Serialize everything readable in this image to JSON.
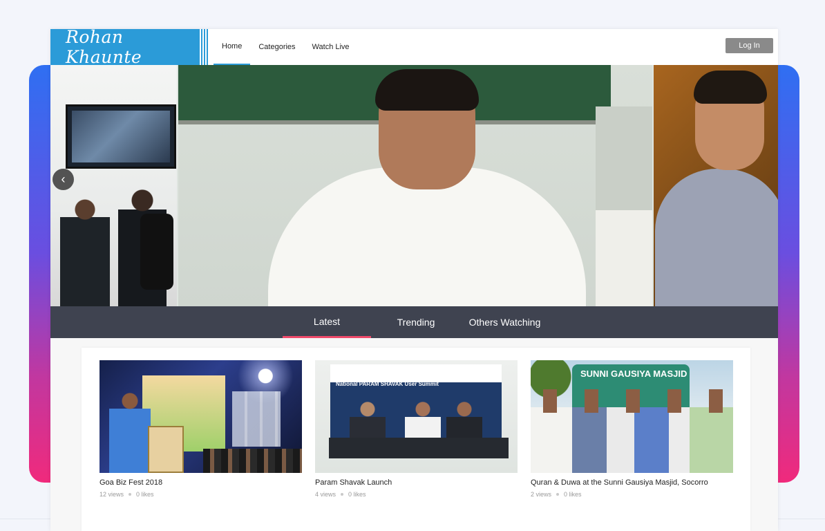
{
  "brand": {
    "name": "Rohan Khaunte"
  },
  "nav": {
    "links": [
      {
        "label": "Home",
        "active": true
      },
      {
        "label": "Categories",
        "active": false
      },
      {
        "label": "Watch Live",
        "active": false
      }
    ],
    "login_label": "Log In"
  },
  "hero": {
    "prev_icon": "‹",
    "slides": 3
  },
  "tabs": [
    {
      "label": "Latest",
      "active": true
    },
    {
      "label": "Trending",
      "active": false
    },
    {
      "label": "Others Watching",
      "active": false
    }
  ],
  "videos": [
    {
      "title": "Goa Biz Fest 2018",
      "views": "12 views",
      "likes": "0 likes"
    },
    {
      "title": "Param Shavak Launch",
      "views": "4 views",
      "likes": "0 likes"
    },
    {
      "title": "Quran & Duwa at the Sunni Gausiya Masjid, Socorro",
      "views": "2 views",
      "likes": "0 likes"
    }
  ],
  "thumb_text": {
    "param": "National PARAM SHAVAK User Summit",
    "masjid": "SUNNI GAUSIYA MASJID"
  },
  "colors": {
    "brand_blue": "#2b9bd8",
    "tab_bar": "#3f4350",
    "tab_active_underline": "#ef4a6b",
    "login_button": "#8a8a8a"
  }
}
